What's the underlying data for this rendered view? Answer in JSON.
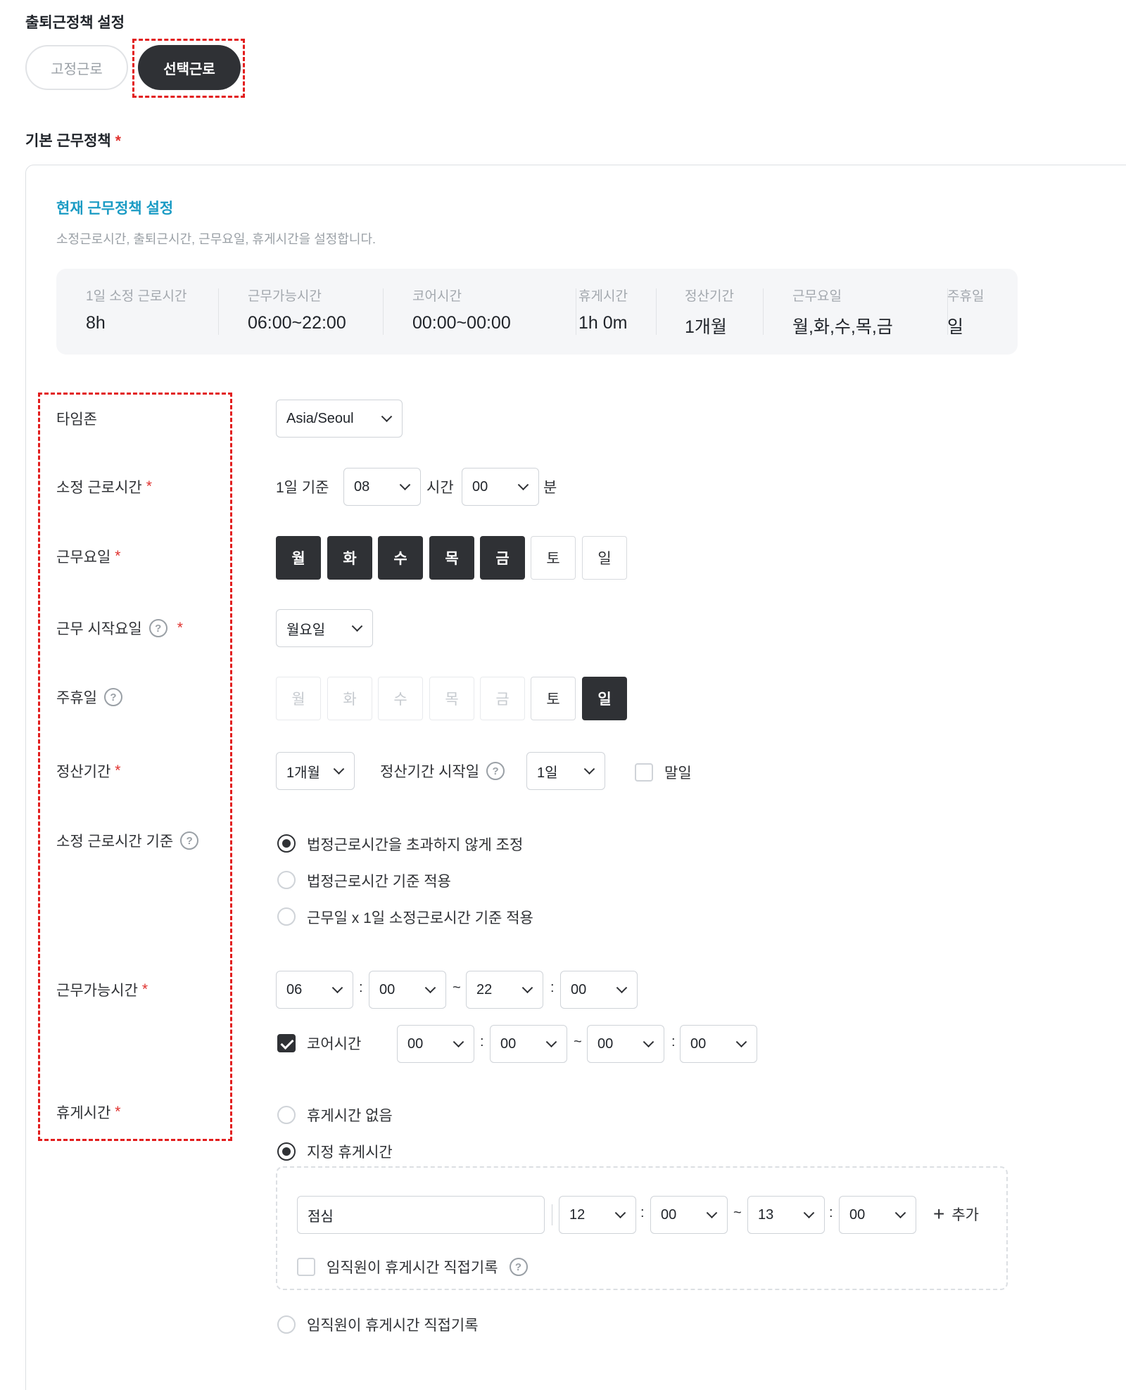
{
  "page_title": "출퇴근정책 설정",
  "mode_tabs": {
    "fixed": "고정근로",
    "selective": "선택근로"
  },
  "section": {
    "title": "기본 근무정책",
    "required": "*"
  },
  "panel": {
    "title": "현재 근무정책 설정",
    "subtitle": "소정근로시간, 출퇴근시간, 근무요일, 휴게시간을 설정합니다."
  },
  "summary": [
    {
      "label": "1일 소정 근로시간",
      "value": "8h"
    },
    {
      "label": "근무가능시간",
      "value": "06:00~22:00"
    },
    {
      "label": "코어시간",
      "value": "00:00~00:00"
    },
    {
      "label": "휴게시간",
      "value": "1h 0m"
    },
    {
      "label": "정산기간",
      "value": "1개월"
    },
    {
      "label": "근무요일",
      "value": "월,화,수,목,금"
    },
    {
      "label": "주휴일",
      "value": "일"
    }
  ],
  "labels": {
    "timezone": "타임존",
    "work_hours": "소정 근로시간",
    "work_days": "근무요일",
    "start_day": "근무 시작요일",
    "weekly_holiday": "주휴일",
    "settlement": "정산기간",
    "work_hours_basis": "소정 근로시간 기준",
    "available_hours": "근무가능시간",
    "break_time": "휴게시간"
  },
  "help_icon": "?",
  "required_mark": "*",
  "timezone": {
    "value": "Asia/Seoul"
  },
  "work_hours": {
    "prefix": "1일 기준",
    "hours": "08",
    "hours_unit": "시간",
    "minutes": "00",
    "minutes_unit": "분"
  },
  "work_days": {
    "days": [
      "월",
      "화",
      "수",
      "목",
      "금",
      "토",
      "일"
    ],
    "selected": [
      true,
      true,
      true,
      true,
      true,
      false,
      false
    ]
  },
  "start_day": {
    "value": "월요일"
  },
  "weekly_holiday": {
    "days": [
      "월",
      "화",
      "수",
      "목",
      "금",
      "토",
      "일"
    ],
    "states": [
      "disabled",
      "disabled",
      "disabled",
      "disabled",
      "disabled",
      "off",
      "on"
    ]
  },
  "settlement": {
    "period": "1개월",
    "start_label": "정산기간 시작일",
    "start_value": "1일",
    "end_of_month": "말일",
    "end_of_month_checked": false
  },
  "work_hours_basis": {
    "options": [
      "법정근로시간을 초과하지 않게 조정",
      "법정근로시간 기준 적용",
      "근무일 x 1일 소정근로시간 기준 적용"
    ],
    "selected": 0
  },
  "available_hours": {
    "start_h": "06",
    "start_m": "00",
    "end_h": "22",
    "end_m": "00",
    "colon": ":",
    "tilde": "~",
    "core_label": "코어시간",
    "core_checked": true,
    "core_start_h": "00",
    "core_start_m": "00",
    "core_end_h": "00",
    "core_end_m": "00"
  },
  "break_time": {
    "options": [
      "휴게시간 없음",
      "지정 휴게시간",
      "임직원이 휴게시간 직접기록"
    ],
    "selected": 1,
    "entry": {
      "name": "점심",
      "start_h": "12",
      "start_m": "00",
      "end_h": "13",
      "end_m": "00"
    },
    "add_label": "추가",
    "self_record_label": "임직원이 휴게시간 직접기록",
    "self_record_checked": false
  }
}
